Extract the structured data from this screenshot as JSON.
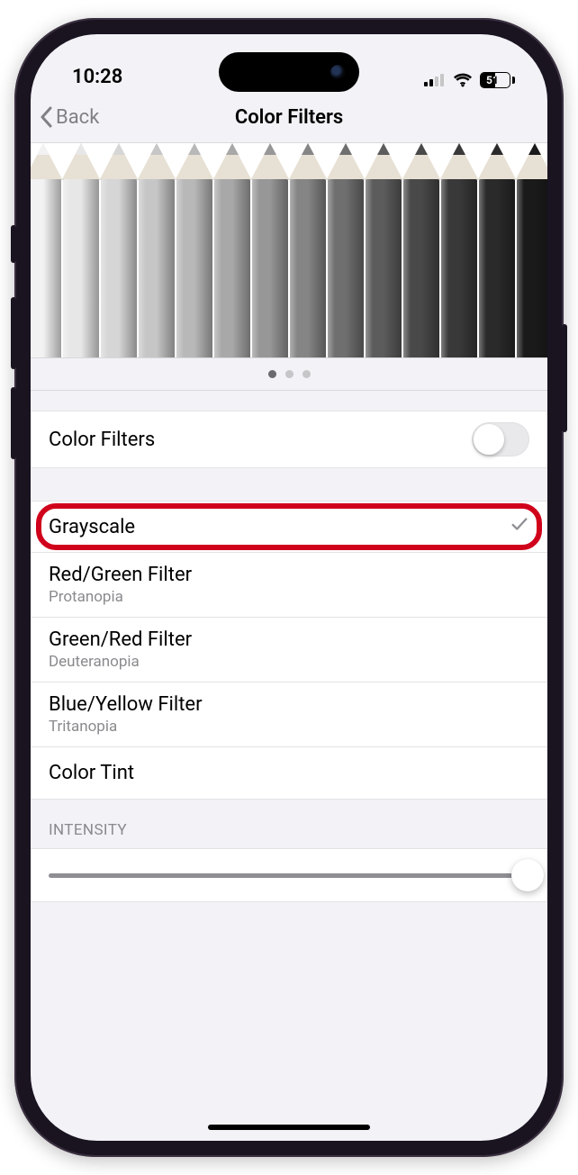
{
  "status": {
    "time": "10:28",
    "battery_pct": "51"
  },
  "nav": {
    "back_label": "Back",
    "title": "Color Filters"
  },
  "preview": {
    "page_dots": {
      "count": 3,
      "active_index": 0
    },
    "pencil_shades": [
      "#f2f2f2",
      "#e7e7e7",
      "#d6d6d6",
      "#c6c6c6",
      "#b8b8b8",
      "#a8a8a8",
      "#979797",
      "#858585",
      "#6f6f6f",
      "#5c5c5c",
      "#494949",
      "#393939",
      "#2a2a2a",
      "#1a1a1a"
    ]
  },
  "toggle": {
    "label": "Color Filters",
    "on": false
  },
  "filters": {
    "items": [
      {
        "label": "Grayscale",
        "sub": null,
        "selected": true
      },
      {
        "label": "Red/Green Filter",
        "sub": "Protanopia",
        "selected": false
      },
      {
        "label": "Green/Red Filter",
        "sub": "Deuteranopia",
        "selected": false
      },
      {
        "label": "Blue/Yellow Filter",
        "sub": "Tritanopia",
        "selected": false
      },
      {
        "label": "Color Tint",
        "sub": null,
        "selected": false
      }
    ]
  },
  "intensity": {
    "header": "INTENSITY",
    "value_pct": 100
  },
  "annotation": {
    "highlight_row_index": 0,
    "highlight_color": "#d0021b"
  }
}
